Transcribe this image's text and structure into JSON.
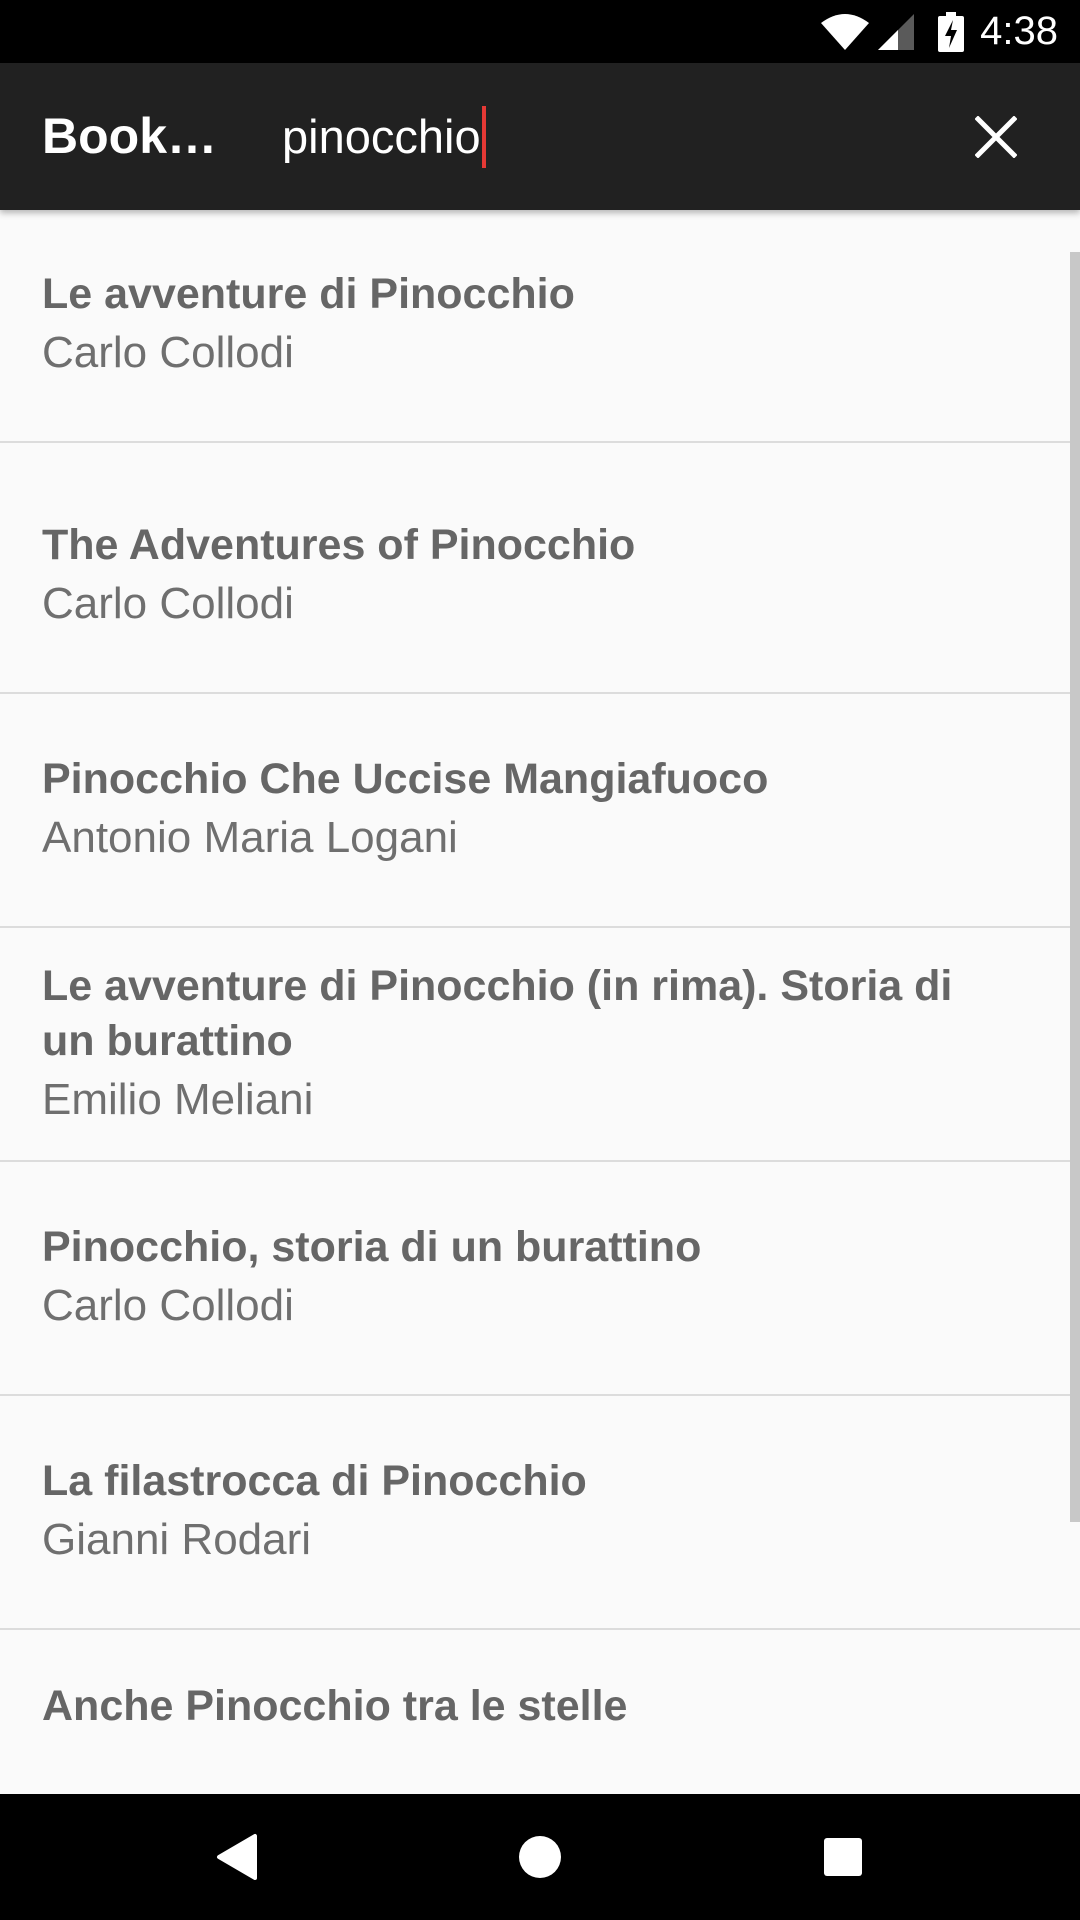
{
  "status_bar": {
    "time": "4:38",
    "icons": [
      "wifi-icon",
      "cell-signal-icon",
      "battery-charging-icon"
    ]
  },
  "toolbar": {
    "title": "Book…",
    "search_value": "pinocchio",
    "close_icon": "close-icon"
  },
  "results": [
    {
      "title": "Le avventure di Pinocchio",
      "author": "Carlo Collodi"
    },
    {
      "title": "The Adventures of Pinocchio",
      "author": "Carlo Collodi"
    },
    {
      "title": "Pinocchio Che Uccise Mangiafuoco",
      "author": "Antonio Maria Logani"
    },
    {
      "title": "Le avventure di Pinocchio (in rima). Storia di un burattino",
      "author": "Emilio Meliani"
    },
    {
      "title": "Pinocchio, storia di un burattino",
      "author": "Carlo Collodi"
    },
    {
      "title": "La filastrocca di Pinocchio",
      "author": "Gianni Rodari"
    },
    {
      "title": "Anche Pinocchio tra le stelle",
      "author": ""
    }
  ],
  "nav_bar": {
    "icons": [
      "back-icon",
      "home-icon",
      "recents-icon"
    ]
  },
  "colors": {
    "status_bar": "#000000",
    "toolbar": "#212121",
    "background": "#fafafa",
    "caret": "#e53935",
    "text_secondary": "#666666"
  }
}
